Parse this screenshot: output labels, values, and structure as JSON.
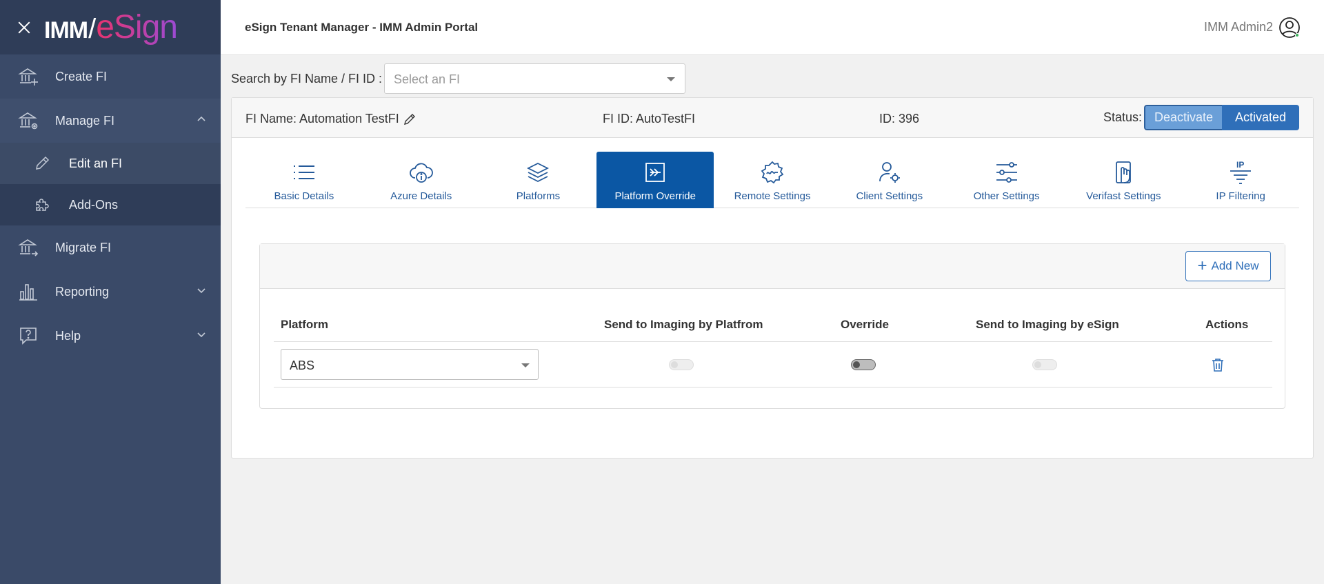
{
  "sidebar": {
    "logo_imm": "IMM",
    "logo_esign": "eSign",
    "items": [
      {
        "label": "Create FI",
        "icon": "bank-plus-icon"
      },
      {
        "label": "Manage FI",
        "icon": "bank-gear-icon"
      },
      {
        "label": "Edit an FI",
        "icon": "pencil-icon"
      },
      {
        "label": "Add-Ons",
        "icon": "puzzle-icon"
      },
      {
        "label": "Migrate FI",
        "icon": "bank-arrow-icon"
      },
      {
        "label": "Reporting",
        "icon": "bar-chart-icon"
      },
      {
        "label": "Help",
        "icon": "help-chat-icon"
      }
    ]
  },
  "header": {
    "title": "eSign Tenant Manager - IMM Admin Portal",
    "user_name": "IMM Admin2"
  },
  "search": {
    "label": "Search by FI Name / FI ID :",
    "placeholder": "Select an FI"
  },
  "info": {
    "fi_name": "FI Name: Automation TestFI",
    "fi_id": "FI ID: AutoTestFI",
    "id": "ID: 396",
    "status_label": "Status:",
    "deactivate": "Deactivate",
    "activated": "Activated"
  },
  "tabs": [
    {
      "label": "Basic Details",
      "icon": "list-icon"
    },
    {
      "label": "Azure Details",
      "icon": "cloud-info-icon"
    },
    {
      "label": "Platforms",
      "icon": "layers-icon"
    },
    {
      "label": "Platform Override",
      "icon": "override-arrow-icon",
      "active": true
    },
    {
      "label": "Remote Settings",
      "icon": "signature-gear-icon"
    },
    {
      "label": "Client Settings",
      "icon": "user-gear-icon"
    },
    {
      "label": "Other Settings",
      "icon": "sliders-icon"
    },
    {
      "label": "Verifast Settings",
      "icon": "hand-phone-icon"
    },
    {
      "label": "IP Filtering",
      "icon": "ip-filter-icon"
    }
  ],
  "override": {
    "add_new": "Add New",
    "columns": [
      "Platform",
      "Send to Imaging by Platfrom",
      "Override",
      "Send to Imaging by eSign",
      "Actions"
    ],
    "rows": [
      {
        "platform": "ABS",
        "send_by_platform": false,
        "override": false,
        "send_by_esign": false
      }
    ]
  },
  "colors": {
    "sidebar": "#3a4a68",
    "accent": "#0b57a4",
    "activated": "#2f6fb9"
  }
}
